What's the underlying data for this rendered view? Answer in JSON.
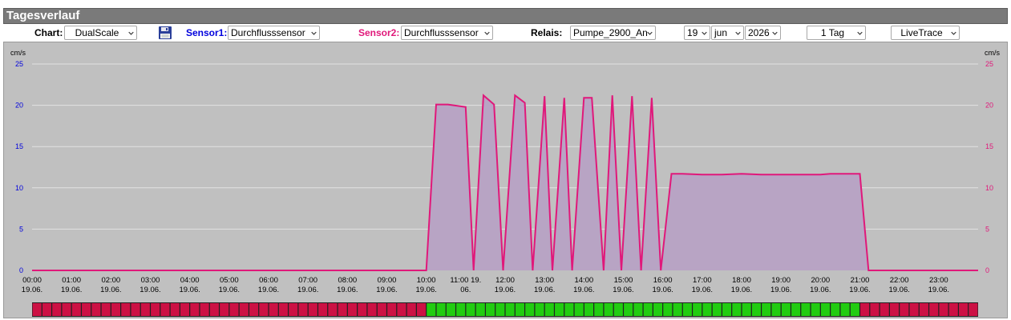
{
  "window": {
    "title": "Tagesverlauf"
  },
  "toolbar": {
    "chart_label": "Chart:",
    "chart_value": "DualScale",
    "sensor1_label": "Sensor1:",
    "sensor1_value": "Durchflusssensor",
    "sensor2_label": "Sensor2:",
    "sensor2_value": "Durchflusssensor",
    "relais_label": "Relais:",
    "relais_value": "Pumpe_2900_An",
    "day_value": "19",
    "month_value": "jun",
    "year_value": "2026",
    "range_value": "1 Tag",
    "mode_value": "LiveTrace"
  },
  "colors": {
    "sensor1": "#0000dd",
    "sensor2": "#e0187a",
    "fill": "#b8a4c4",
    "relay_on": "#22cc11",
    "relay_off": "#cc1144"
  },
  "icons": {
    "save": "floppy-disk-icon",
    "dropdown": "chevron-down-icon"
  },
  "chart_data": {
    "type": "area",
    "y_unit_left": "cm/s",
    "y_unit_right": "cm/s",
    "ylim": [
      0,
      25
    ],
    "yticks": [
      0,
      5,
      10,
      15,
      20,
      25
    ],
    "xlim": [
      0,
      24
    ],
    "grid": true,
    "x_ticks": [
      {
        "t": 0,
        "l1": "00:00",
        "l2": "19.06."
      },
      {
        "t": 1,
        "l1": "01:00",
        "l2": "19.06."
      },
      {
        "t": 2,
        "l1": "02:00",
        "l2": "19.06."
      },
      {
        "t": 3,
        "l1": "03:00",
        "l2": "19.06."
      },
      {
        "t": 4,
        "l1": "04:00",
        "l2": "19.06."
      },
      {
        "t": 5,
        "l1": "05:00",
        "l2": "19.06."
      },
      {
        "t": 6,
        "l1": "06:00",
        "l2": "19.06."
      },
      {
        "t": 7,
        "l1": "07:00",
        "l2": "19.06."
      },
      {
        "t": 8,
        "l1": "08:00",
        "l2": "19.06."
      },
      {
        "t": 9,
        "l1": "09:00",
        "l2": "19.06."
      },
      {
        "t": 10,
        "l1": "10:00",
        "l2": "19.06."
      },
      {
        "t": 11,
        "l1": "11:00 19.",
        "l2": "06."
      },
      {
        "t": 12,
        "l1": "12:00",
        "l2": "19.06."
      },
      {
        "t": 13,
        "l1": "13:00",
        "l2": "19.06."
      },
      {
        "t": 14,
        "l1": "14:00",
        "l2": "19.06."
      },
      {
        "t": 15,
        "l1": "15:00",
        "l2": "19.06."
      },
      {
        "t": 16,
        "l1": "16:00",
        "l2": "19.06."
      },
      {
        "t": 17,
        "l1": "17:00",
        "l2": "19.06."
      },
      {
        "t": 18,
        "l1": "18:00",
        "l2": "19.06."
      },
      {
        "t": 19,
        "l1": "19:00",
        "l2": "19.06."
      },
      {
        "t": 20,
        "l1": "20:00",
        "l2": "19.06."
      },
      {
        "t": 21,
        "l1": "21:00",
        "l2": "19.06."
      },
      {
        "t": 22,
        "l1": "22:00",
        "l2": "19.06."
      },
      {
        "t": 23,
        "l1": "23:00",
        "l2": "19.06."
      }
    ],
    "series": [
      {
        "x": [
          0,
          10.0,
          10.25,
          10.55,
          11.0,
          11.2,
          11.45,
          11.72,
          11.95,
          12.25,
          12.5,
          12.7,
          13.0,
          13.2,
          13.5,
          13.7,
          14.0,
          14.2,
          14.5,
          14.72,
          14.95,
          15.22,
          15.45,
          15.72,
          15.95,
          16.22,
          16.5,
          17.0,
          17.5,
          18.0,
          18.5,
          19.0,
          19.5,
          20.0,
          20.25,
          20.5,
          21.0,
          21.22,
          21.5,
          24
        ],
        "y": [
          0,
          0,
          20.1,
          20.1,
          19.8,
          0,
          21.2,
          20.1,
          0,
          21.2,
          20.3,
          0,
          21.1,
          0,
          20.9,
          0,
          20.9,
          20.9,
          0,
          21.2,
          0,
          21.1,
          0,
          20.9,
          0,
          11.7,
          11.7,
          11.6,
          11.6,
          11.7,
          11.6,
          11.6,
          11.6,
          11.6,
          11.7,
          11.7,
          11.7,
          0,
          0,
          0
        ]
      }
    ],
    "relay_segments": [
      {
        "from": 0,
        "to": 10,
        "state": "off"
      },
      {
        "from": 10,
        "to": 21,
        "state": "on"
      },
      {
        "from": 21,
        "to": 24,
        "state": "off"
      }
    ]
  }
}
